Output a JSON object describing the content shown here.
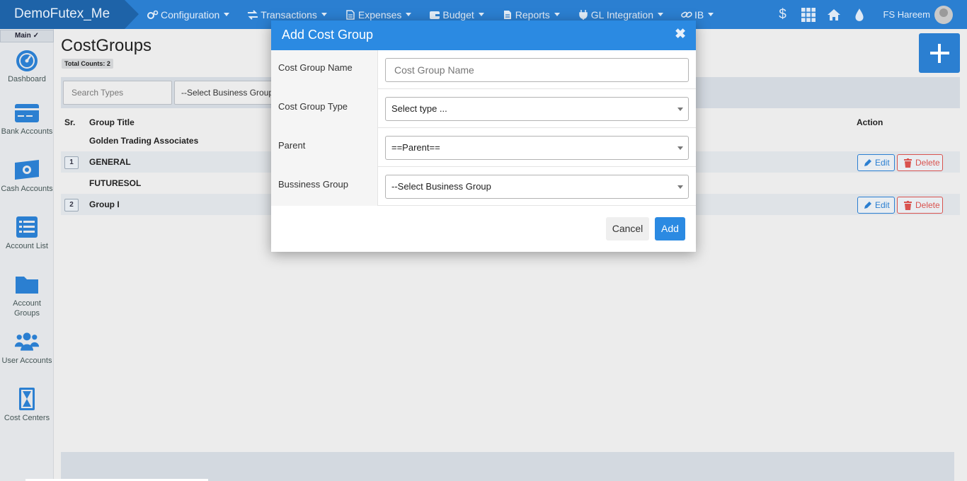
{
  "brand": "DemoFutex_Me",
  "nav": [
    {
      "label": "Configuration",
      "icon": "gears-icon"
    },
    {
      "label": "Transactions",
      "icon": "exchange-icon"
    },
    {
      "label": "Expenses",
      "icon": "document-icon"
    },
    {
      "label": "Budget",
      "icon": "wallet-icon"
    },
    {
      "label": "Reports",
      "icon": "report-icon"
    },
    {
      "label": "GL Integration",
      "icon": "plug-icon"
    },
    {
      "label": "IB",
      "icon": "link-icon"
    }
  ],
  "header_right": {
    "icons": [
      "dollar-icon",
      "apps-grid-icon",
      "home-icon",
      "drop-icon"
    ],
    "user_name": "FS Hareem"
  },
  "sidebar": {
    "main_tab": "Main",
    "items": [
      {
        "label": "Dashboard",
        "icon": "dashboard-icon"
      },
      {
        "label": "Bank Accounts",
        "icon": "bank-card-icon"
      },
      {
        "label": "Cash Accounts",
        "icon": "cash-icon"
      },
      {
        "label": "Account List",
        "icon": "list-icon"
      },
      {
        "label": "Account Groups",
        "icon": "folder-icon"
      },
      {
        "label": "User Accounts",
        "icon": "users-icon"
      },
      {
        "label": "Cost Centers",
        "icon": "cost-center-icon"
      }
    ]
  },
  "page": {
    "title": "CostGroups",
    "total_counts": "Total Counts: 2",
    "search_placeholder": "Search Types",
    "business_group_select": "--Select Business Group"
  },
  "table": {
    "headers": {
      "sr": "Sr.",
      "group_title": "Group Title",
      "action": "Action"
    },
    "rows": [
      {
        "sr": "",
        "title": "Golden Trading Associates",
        "actions": false
      },
      {
        "sr": "1",
        "title": "GENERAL",
        "actions": true
      },
      {
        "sr": "",
        "title": "FUTURESOL",
        "actions": false
      },
      {
        "sr": "2",
        "title": "Group I",
        "actions": true
      }
    ],
    "edit_label": "Edit",
    "delete_label": "Delete"
  },
  "modal": {
    "title": "Add Cost Group",
    "close_glyph": "✖",
    "fields": [
      {
        "label": "Cost Group Name",
        "type": "input",
        "placeholder": "Cost Group Name",
        "value": ""
      },
      {
        "label": "Cost Group Type",
        "type": "select",
        "value": "Select type ..."
      },
      {
        "label": "Parent",
        "type": "select",
        "value": "==Parent=="
      },
      {
        "label": "Bussiness Group",
        "type": "select",
        "value": "--Select Business Group"
      }
    ],
    "cancel_label": "Cancel",
    "add_label": "Add"
  },
  "colors": {
    "primary": "#2b7fd1",
    "modal_header": "#2b8ae2",
    "danger": "#d9534f"
  }
}
